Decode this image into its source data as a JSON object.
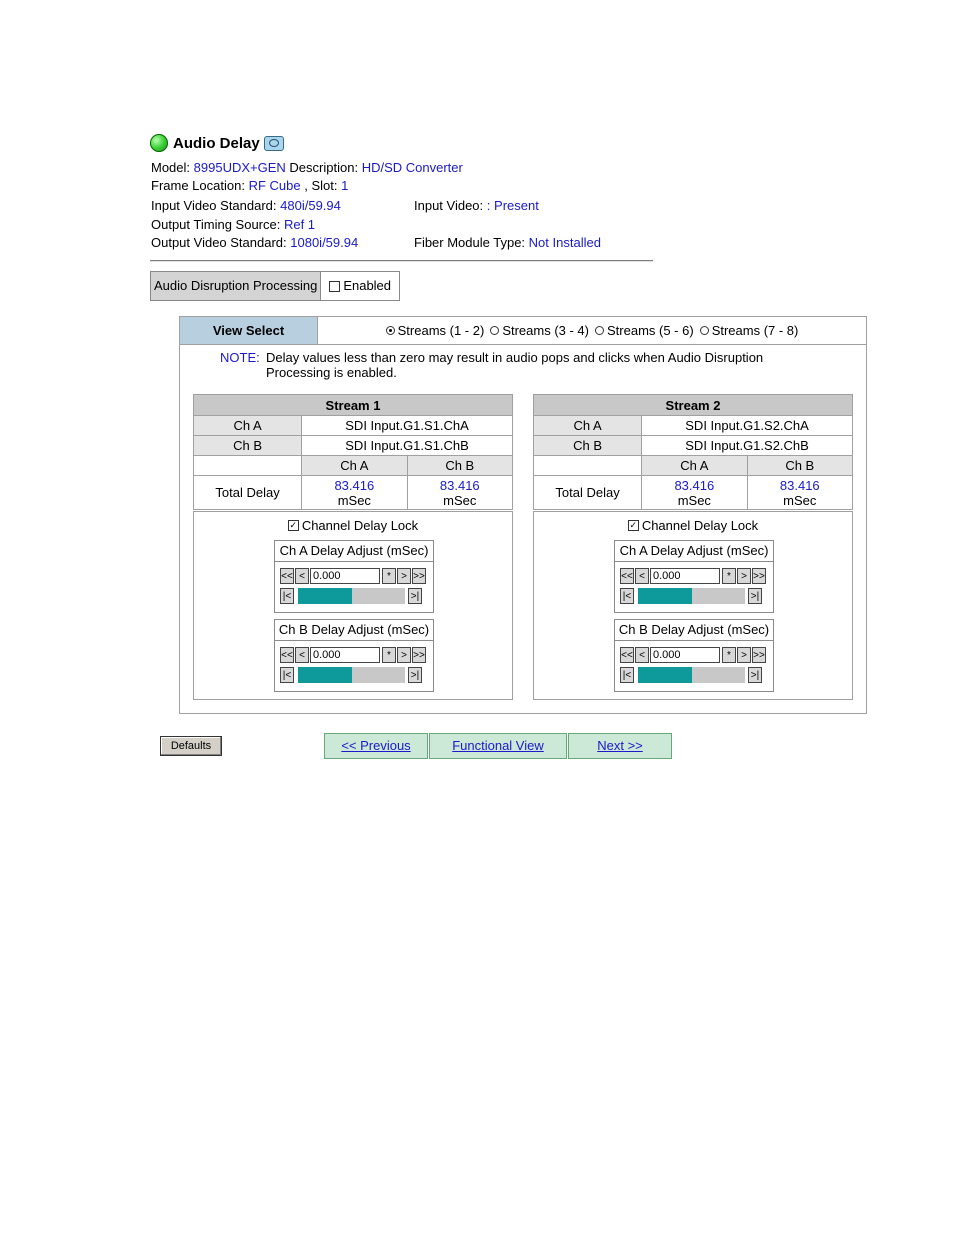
{
  "header": {
    "title": "Audio Delay"
  },
  "info": {
    "model_label": "Model:",
    "model": "8995UDX+GEN",
    "description_label": "Description:",
    "description": "HD/SD Converter",
    "frame_location_label": "Frame Location:",
    "frame_location": "RF Cube",
    "slot_label": ", Slot:",
    "slot": "1",
    "input_video_standard_label": "Input Video Standard:",
    "input_video_standard": "480i/59.94",
    "input_video_label": "Input Video:",
    "input_video_prefix": ":",
    "input_video": "Present",
    "output_timing_source_label": "Output Timing Source:",
    "output_timing_source": "Ref 1",
    "output_video_standard_label": "Output Video Standard:",
    "output_video_standard": "1080i/59.94",
    "fiber_module_type_label": "Fiber Module Type:",
    "fiber_module_type": "Not Installed"
  },
  "disruption": {
    "label": "Audio Disruption Processing",
    "checkbox_label": "Enabled",
    "checked": false
  },
  "view_select": {
    "label": "View Select",
    "options": [
      {
        "label": "Streams (1 - 2)",
        "selected": true
      },
      {
        "label": "Streams (3 - 4)",
        "selected": false
      },
      {
        "label": "Streams (5 - 6)",
        "selected": false
      },
      {
        "label": "Streams (7 - 8)",
        "selected": false
      }
    ]
  },
  "note": {
    "label": "NOTE:",
    "line1": "Delay values less than zero may result in audio pops and clicks when Audio Disruption",
    "line2": "Processing is enabled."
  },
  "streams": [
    {
      "title": "Stream 1",
      "ch_a_label": "Ch A",
      "ch_a_source": "SDI Input.G1.S1.ChA",
      "ch_b_label": "Ch B",
      "ch_b_source": "SDI Input.G1.S1.ChB",
      "col_a": "Ch A",
      "col_b": "Ch B",
      "total_delay_label": "Total Delay",
      "total_a": "83.416",
      "total_b": "83.416",
      "unit": "mSec",
      "lock_label": "Channel Delay Lock",
      "lock_checked": true,
      "adjust_a_label": "Ch A Delay Adjust (mSec)",
      "adjust_a_value": "0.000",
      "adjust_a_level": 0.5,
      "adjust_b_label": "Ch B Delay Adjust (mSec)",
      "adjust_b_value": "0.000",
      "adjust_b_level": 0.5
    },
    {
      "title": "Stream 2",
      "ch_a_label": "Ch A",
      "ch_a_source": "SDI Input.G1.S2.ChA",
      "ch_b_label": "Ch B",
      "ch_b_source": "SDI Input.G1.S2.ChB",
      "col_a": "Ch A",
      "col_b": "Ch B",
      "total_delay_label": "Total Delay",
      "total_a": "83.416",
      "total_b": "83.416",
      "unit": "mSec",
      "lock_label": "Channel Delay Lock",
      "lock_checked": true,
      "adjust_a_label": "Ch A Delay Adjust (mSec)",
      "adjust_a_value": "0.000",
      "adjust_a_level": 0.5,
      "adjust_b_label": "Ch B Delay Adjust (mSec)",
      "adjust_b_value": "0.000",
      "adjust_b_level": 0.5
    }
  ],
  "spinner": {
    "fast_back": "<<",
    "back": "<",
    "default": "*",
    "forward": ">",
    "fast_forward": ">>",
    "min": "|<",
    "max": ">|"
  },
  "buttons": {
    "defaults": "Defaults",
    "previous": "<< Previous",
    "functional_view": "Functional View",
    "next": "Next >>"
  },
  "colors": {
    "link": "#1a1acc",
    "slider_fill": "#0e9a9a",
    "header_bg": "#b8cfe0",
    "nav_bg": "#cce8d6"
  }
}
